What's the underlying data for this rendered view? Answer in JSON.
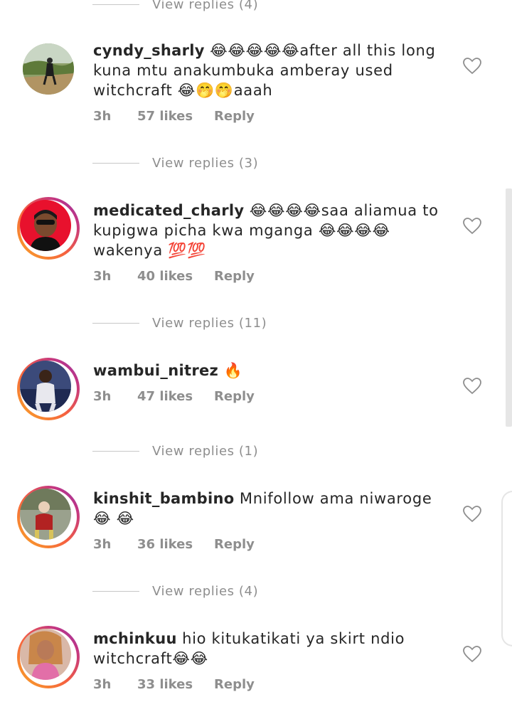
{
  "comments": [
    {
      "username": "cyndy_sharly",
      "text": "😂😂😂😂😂after all this long kuna mtu anakumbuka amberay used witchcraft 😂🤭🤭aaah",
      "time": "3h",
      "likes": "57 likes",
      "reply": "Reply",
      "view_replies": "View replies (3)"
    },
    {
      "username": "medicated_charly",
      "text": "😂😂😂😂saa aliamua to kupigwa picha kwa mganga 😂😂😂😂 wakenya 💯💯",
      "time": "3h",
      "likes": "40 likes",
      "reply": "Reply",
      "view_replies": "View replies (11)"
    },
    {
      "username": "wambui_nitrez",
      "text": "🔥",
      "time": "3h",
      "likes": "47 likes",
      "reply": "Reply",
      "view_replies": "View replies (1)"
    },
    {
      "username": "kinshit_bambino",
      "text": "Mnifollow ama niwaroge😂 😂",
      "time": "3h",
      "likes": "36 likes",
      "reply": "Reply",
      "view_replies": "View replies (4)"
    },
    {
      "username": "mchinkuu",
      "text": "hio kitukatikati ya skirt ndio witchcraft😂😂",
      "time": "3h",
      "likes": "33 likes",
      "reply": "Reply"
    }
  ],
  "top_view_replies": "View replies (4)",
  "colors": {
    "text": "#262626",
    "muted": "#8e8e8e",
    "ring_start": "#f9a825",
    "ring_end": "#c13584"
  }
}
